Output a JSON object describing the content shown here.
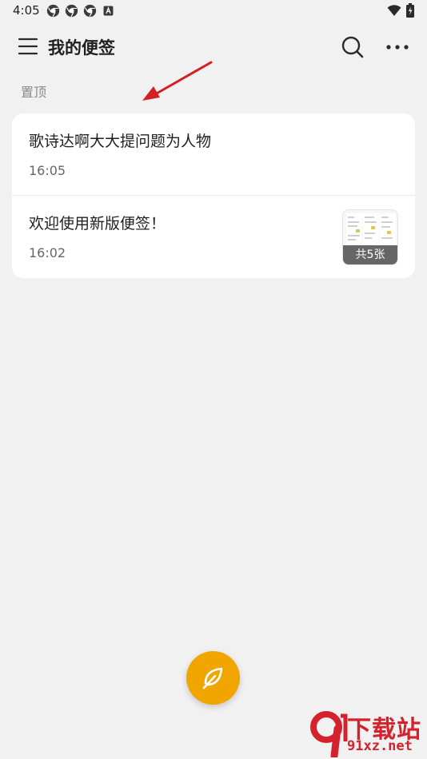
{
  "status_bar": {
    "time": "4:05",
    "left_icons": [
      "chrome-icon",
      "chrome-icon",
      "chrome-icon",
      "a-box-icon"
    ],
    "right_icons": [
      "wifi-icon",
      "battery-charging-icon"
    ]
  },
  "app_bar": {
    "title": "我的便签",
    "icons": [
      "menu-icon",
      "search-icon",
      "more-icon"
    ]
  },
  "section": {
    "label": "置顶"
  },
  "notes": [
    {
      "title": "歌诗达啊大大提问题为人物",
      "time": "16:05"
    },
    {
      "title": "欢迎使用新版便签！",
      "time": "16:02",
      "thumbnail_badge": "共5张"
    }
  ],
  "fab": {
    "icon": "feather-pen-icon"
  },
  "watermark": {
    "logo_text": "9",
    "site": "下载站",
    "url": "91xz.net"
  },
  "colors": {
    "background": "#f1f1f1",
    "card": "#ffffff",
    "accent": "#f0a500",
    "annotation_arrow": "#d42020",
    "watermark": "#d3222c"
  }
}
